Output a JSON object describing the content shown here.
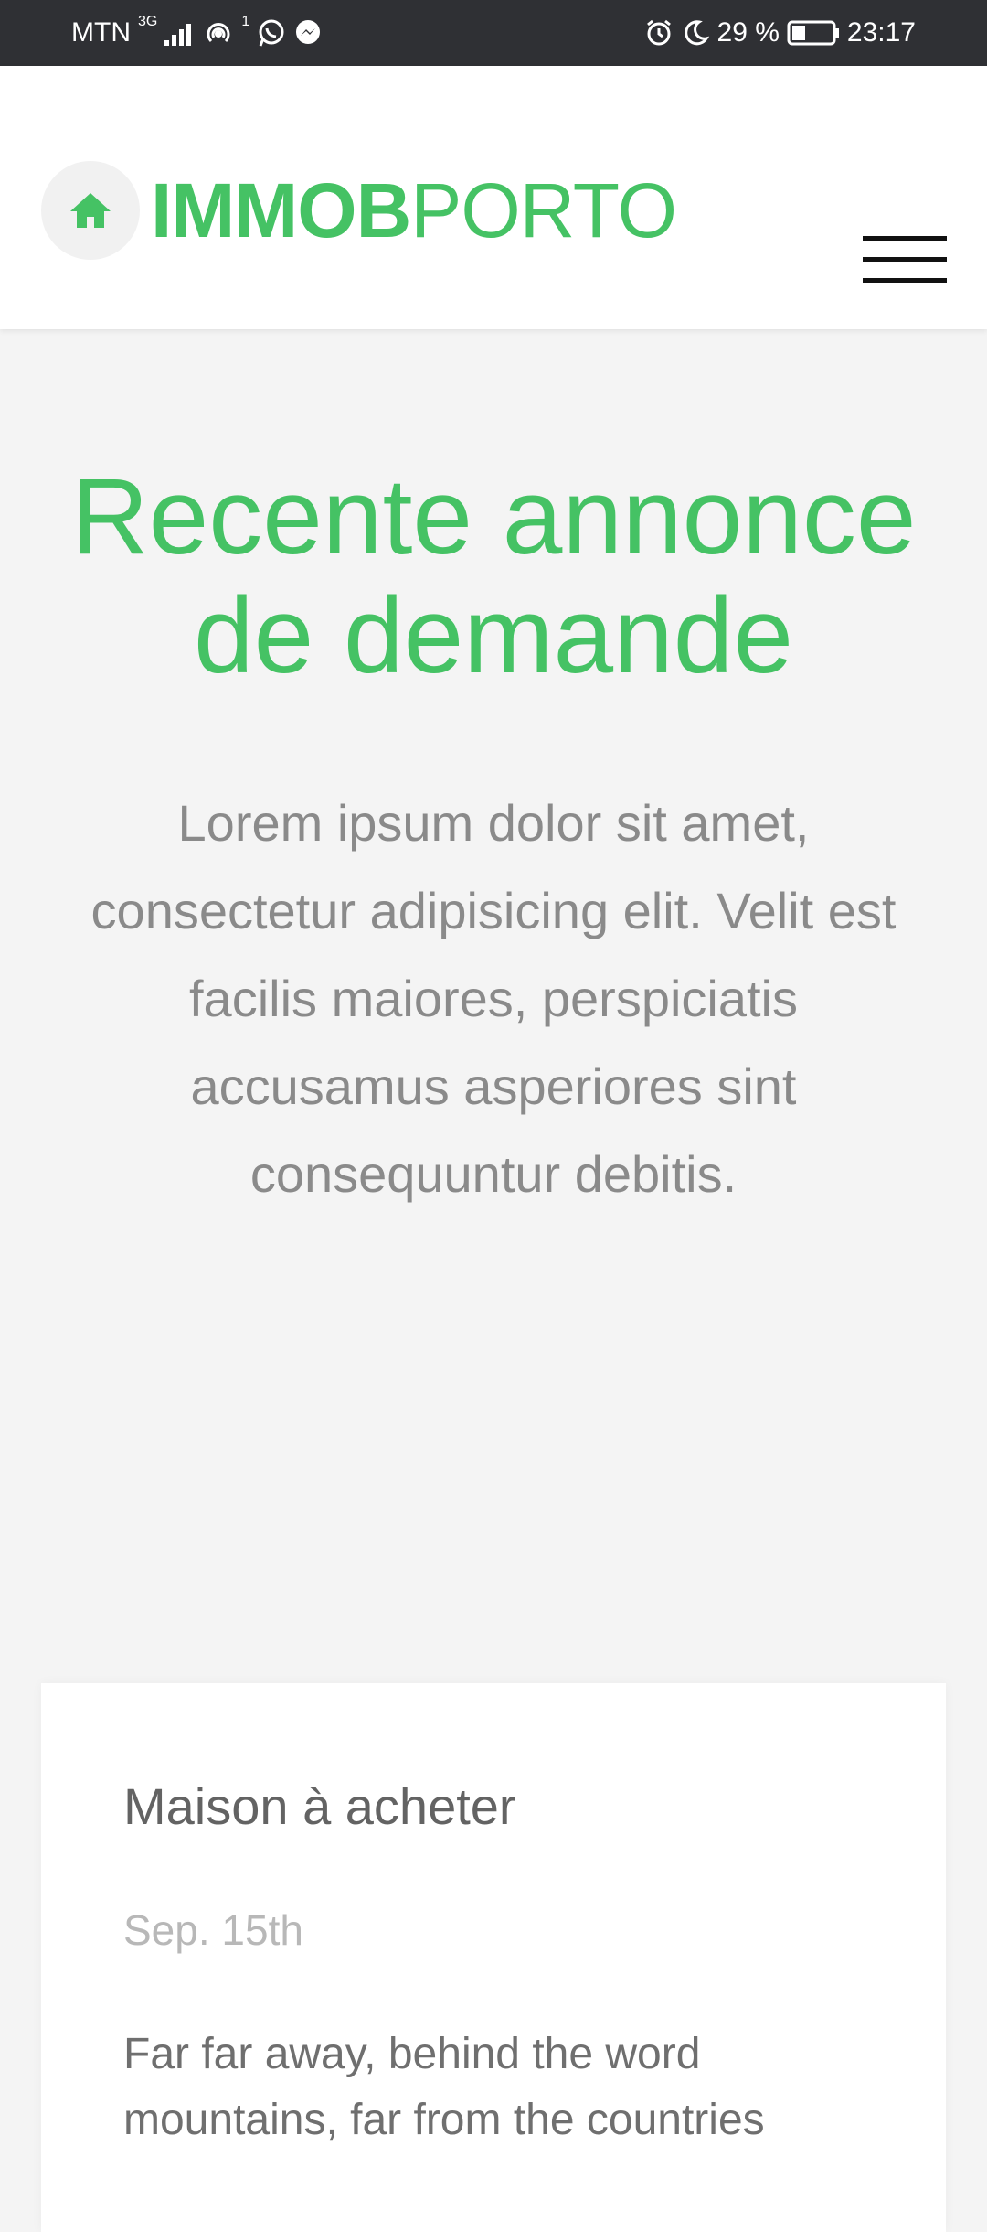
{
  "status_bar": {
    "carrier": "MTN",
    "network": "3G",
    "hotspot_count": "1",
    "battery": "29 %",
    "time": "23:17",
    "icons": [
      "signal-icon",
      "hotspot-icon",
      "whatsapp-icon",
      "messenger-icon",
      "alarm-icon",
      "moon-icon",
      "battery-icon"
    ]
  },
  "header": {
    "brand_bold": "IMMOB",
    "brand_light": "PORTO",
    "logo_icon": "home-icon",
    "menu_icon": "hamburger-menu-icon"
  },
  "hero": {
    "title": "Recente annonce de demande",
    "text": "Lorem ipsum dolor sit amet, consectetur adipisicing elit. Velit est facilis maiores, perspiciatis accusamus asperiores sint consequuntur debitis."
  },
  "card": {
    "title": "Maison à acheter",
    "date": "Sep. 15th",
    "excerpt": "Far far away, behind the word mountains, far from the countries"
  },
  "colors": {
    "accent": "#45c264",
    "status_bar_bg": "#2f3034",
    "page_bg": "#f4f4f4"
  }
}
